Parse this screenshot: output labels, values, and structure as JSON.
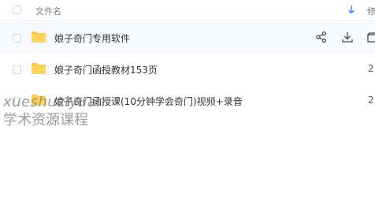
{
  "header": {
    "name_label": "文件名",
    "extra_label": "修"
  },
  "rows": [
    {
      "name": "娘子奇门专用软件",
      "extra": ""
    },
    {
      "name": "娘子奇门函授教材153页",
      "extra": "2"
    },
    {
      "name": "娘子奇门函授课(10分钟学会奇门)视频+录音",
      "extra": "2"
    }
  ],
  "watermark": {
    "line1": "xueshuziyuan",
    "line2": "学术资源课程"
  },
  "icons": {
    "folder": "folder-icon",
    "share": "share-icon",
    "download": "download-icon",
    "sort": "sort-down-icon"
  },
  "colors": {
    "folder": "#ffc94a",
    "accent": "#2f8cf0",
    "hover_row": "#f6f9fd"
  }
}
